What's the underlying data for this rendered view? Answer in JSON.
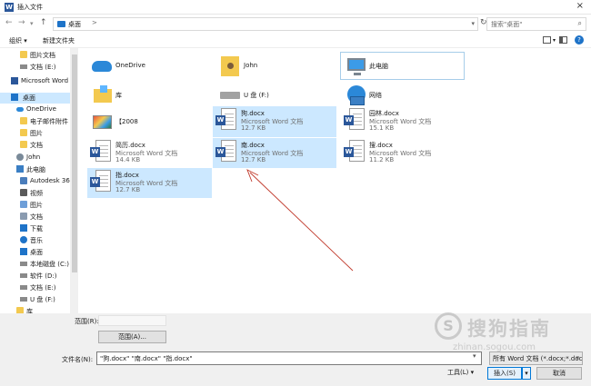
{
  "window": {
    "title": "插入文件",
    "app_icon": "word-icon",
    "close_label": "×"
  },
  "address": {
    "path": "桌面",
    "chevron": ">",
    "search_placeholder": "搜索\"桌面\""
  },
  "toolbar": {
    "organize_label": "组织 ▾",
    "new_folder_label": "新建文件夹",
    "help_label": "?"
  },
  "sidebar": {
    "items": [
      {
        "label": "图片文档",
        "icon": "folder-icon"
      },
      {
        "label": "文档 (E:)",
        "icon": "drive-icon"
      },
      {
        "label": "Microsoft Word",
        "icon": "word-icon"
      },
      {
        "label": "桌面",
        "icon": "desktop-icon",
        "selected": true
      },
      {
        "label": "OneDrive",
        "icon": "cloud-icon"
      },
      {
        "label": "电子邮件附件",
        "icon": "folder-icon"
      },
      {
        "label": "图片",
        "icon": "folder-icon"
      },
      {
        "label": "文档",
        "icon": "folder-icon"
      },
      {
        "label": "John",
        "icon": "user-icon"
      },
      {
        "label": "此电脑",
        "icon": "computer-icon"
      },
      {
        "label": "Autodesk 360",
        "icon": "folder-icon"
      },
      {
        "label": "视频",
        "icon": "video-icon"
      },
      {
        "label": "图片",
        "icon": "picture-icon"
      },
      {
        "label": "文档",
        "icon": "document-icon"
      },
      {
        "label": "下载",
        "icon": "download-icon"
      },
      {
        "label": "音乐",
        "icon": "music-icon"
      },
      {
        "label": "桌面",
        "icon": "desktop-icon"
      },
      {
        "label": "本地磁盘 (C:)",
        "icon": "drive-icon"
      },
      {
        "label": "软件 (D:)",
        "icon": "drive-icon"
      },
      {
        "label": "文档 (E:)",
        "icon": "drive-icon"
      },
      {
        "label": "U 盘 (F:)",
        "icon": "drive-icon"
      },
      {
        "label": "库",
        "icon": "library-icon"
      }
    ]
  },
  "files": [
    {
      "name": "OneDrive",
      "type": "",
      "size": "",
      "icon": "onedrive-icon"
    },
    {
      "name": "John",
      "type": "",
      "size": "",
      "icon": "user-folder-icon"
    },
    {
      "name": "此电脑",
      "type": "",
      "size": "",
      "icon": "computer-icon"
    },
    {
      "name": "库",
      "type": "",
      "size": "",
      "icon": "library-icon"
    },
    {
      "name": "U 盘 (F:)",
      "type": "",
      "size": "",
      "icon": "usb-drive-icon"
    },
    {
      "name": "网络",
      "type": "",
      "size": "",
      "icon": "network-icon"
    },
    {
      "name": "【2008",
      "type": "",
      "size": "",
      "icon": "image-thumbnail-icon"
    },
    {
      "name": "狗.docx",
      "type": "Microsoft Word 文档",
      "size": "12.7 KB",
      "icon": "word-doc-icon",
      "selected": true
    },
    {
      "name": "园林.docx",
      "type": "Microsoft Word 文档",
      "size": "15.1 KB",
      "icon": "word-doc-icon"
    },
    {
      "name": "简历.docx",
      "type": "Microsoft Word 文档",
      "size": "14.4 KB",
      "icon": "word-doc-icon"
    },
    {
      "name": "南.docx",
      "type": "Microsoft Word 文档",
      "size": "12.7 KB",
      "icon": "word-doc-icon",
      "selected": true
    },
    {
      "name": "搜.docx",
      "type": "Microsoft Word 文档",
      "size": "11.2 KB",
      "icon": "word-doc-icon"
    },
    {
      "name": "指.docx",
      "type": "Microsoft Word 文档",
      "size": "12.7 KB",
      "icon": "word-doc-icon",
      "selected": true
    }
  ],
  "bottom": {
    "range_label": "范围(R):",
    "range_value": "",
    "range_button": "范围(A)...",
    "filename_label": "文件名(N):",
    "filename_value": "\"狗.docx\" \"南.docx\" \"指.docx\"",
    "filetype_value": "所有 Word 文档 (*.docx;*.doc",
    "tools_label": "工具(L)  ▾",
    "insert_label": "插入(S)",
    "insert_dropdown": "▾",
    "cancel_label": "取消"
  },
  "watermark": {
    "logo": "S",
    "text": "搜狗指南",
    "url": "zhinan.sogou.com"
  },
  "colors": {
    "selection": "#cce8ff",
    "accent": "#0078d7",
    "word_blue": "#2b579a",
    "annotation_arrow": "#c0392b"
  }
}
